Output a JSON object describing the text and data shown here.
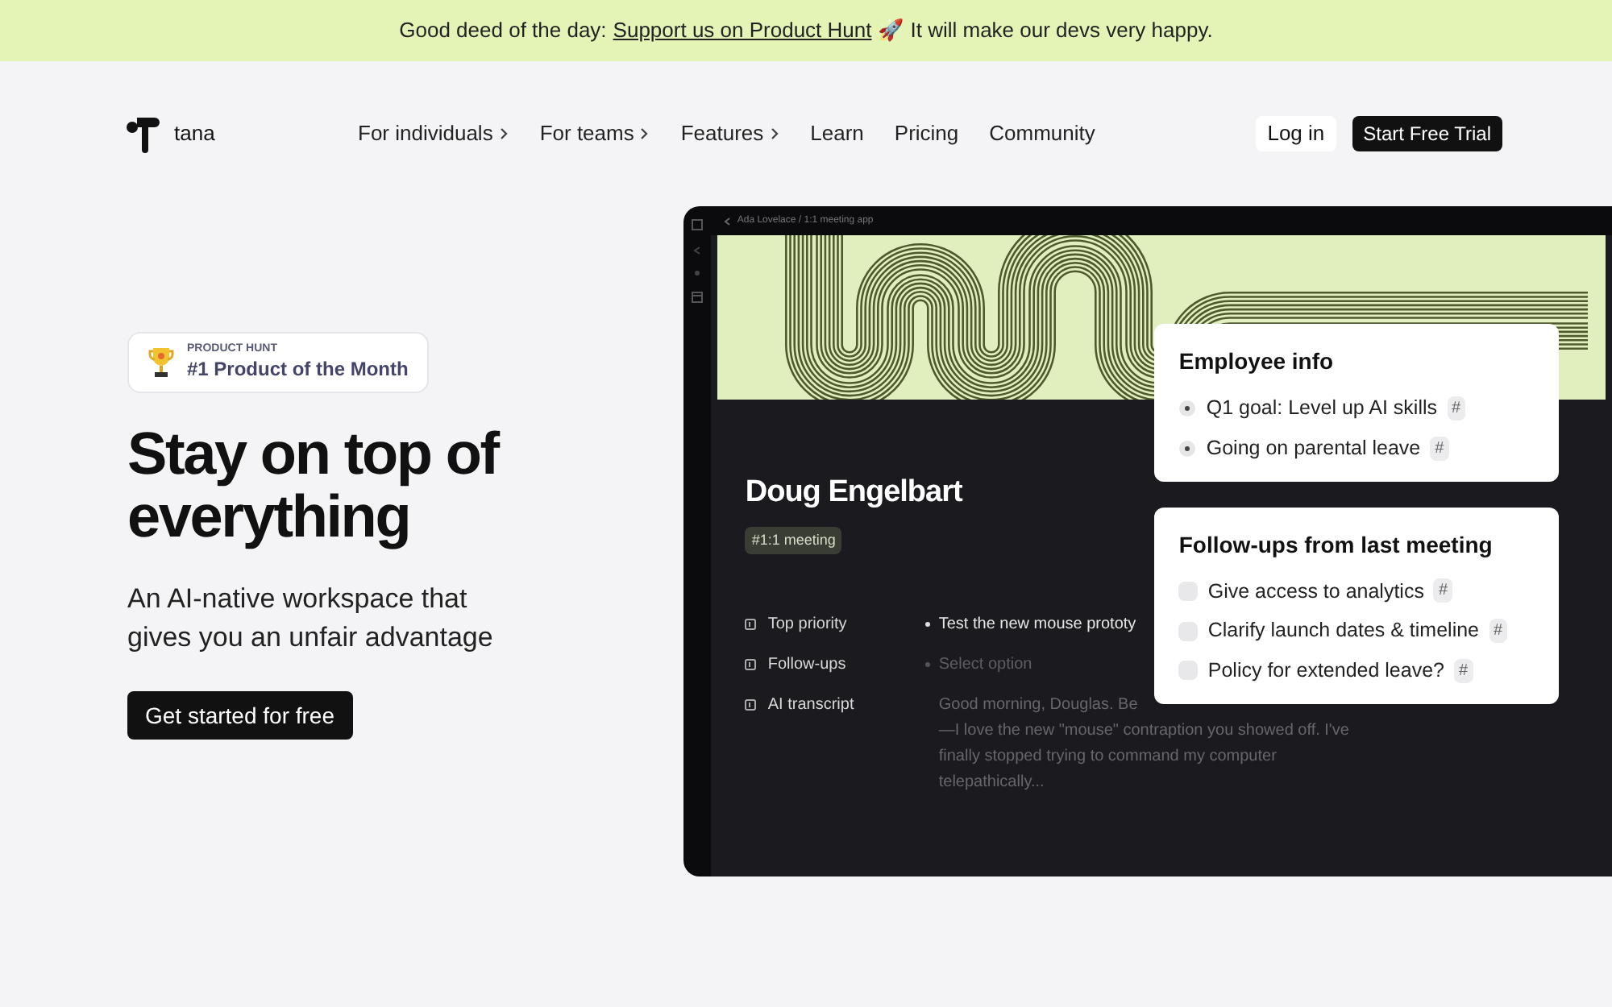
{
  "banner": {
    "text": "Good deed of the day:",
    "link": "Support us on Product Hunt",
    "emoji": "🚀",
    "suffix": "It will make our devs very happy."
  },
  "logo": {
    "name": "tana"
  },
  "nav": [
    {
      "label": "For individuals",
      "has_menu": true
    },
    {
      "label": "For teams",
      "has_menu": true
    },
    {
      "label": "Features",
      "has_menu": true
    },
    {
      "label": "Learn",
      "has_menu": false
    },
    {
      "label": "Pricing",
      "has_menu": false
    },
    {
      "label": "Community",
      "has_menu": false
    }
  ],
  "login": "Log in",
  "trial": "Start Free Trial",
  "award": {
    "eyebrow": "PRODUCT HUNT",
    "title": "#1 Product of the Month"
  },
  "headline": "Stay on top of everything",
  "subhead": "An AI-native workspace that gives you an unfair advantage",
  "cta": "Get started for free",
  "app": {
    "breadcrumb": "Ada Lovelace / 1:1 meeting app",
    "person": "Doug Engelbart",
    "tag": "#1:1 meeting",
    "fields": [
      {
        "label": "Top priority",
        "value": "Test the new mouse prototy",
        "kind": "bullet"
      },
      {
        "label": "Follow-ups",
        "placeholder": "Select option",
        "kind": "placeholder"
      },
      {
        "label": "AI transcript",
        "value": "Good morning, Douglas. Be\n—I love the new \"mouse\" contraption you showed off. I've\nfinally stopped trying to command my computer\ntelepathically...",
        "kind": "text"
      }
    ]
  },
  "cards": [
    {
      "title": "Employee info",
      "items": [
        {
          "text": "Q1 goal: Level up AI skills",
          "kind": "radio",
          "tag": "#"
        },
        {
          "text": "Going on parental leave",
          "kind": "radio",
          "tag": "#"
        }
      ]
    },
    {
      "title": "Follow-ups from last meeting",
      "items": [
        {
          "text": "Give access to analytics",
          "kind": "checkbox",
          "checked": false,
          "tag": "#"
        },
        {
          "text": "Clarify launch dates & timeline",
          "kind": "checkbox",
          "checked": false,
          "tag": "#"
        },
        {
          "text": "Policy for extended leave?",
          "kind": "checkbox",
          "checked": false,
          "tag": "#"
        }
      ]
    }
  ]
}
